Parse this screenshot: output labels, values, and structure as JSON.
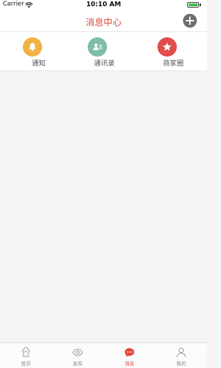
{
  "status_bar": {
    "carrier": "Carrier",
    "time": "10:10 AM",
    "battery_level": 1.0,
    "battery_color": "#37c14a"
  },
  "nav": {
    "title": "消息中心",
    "title_color": "#e0463f",
    "add_icon": "plus-circle-icon"
  },
  "categories": [
    {
      "label": "通知",
      "icon": "bell-icon",
      "color": "#f2b242"
    },
    {
      "label": "通讯录",
      "icon": "contacts-card-icon",
      "color": "#7fbda7"
    },
    {
      "label": "商家圈",
      "icon": "star-icon",
      "color": "#e14c4c"
    }
  ],
  "tabs": [
    {
      "label": "首页",
      "icon": "home-icon",
      "active": false
    },
    {
      "label": "发现",
      "icon": "eye-icon",
      "active": false
    },
    {
      "label": "消息",
      "icon": "chat-bubble-icon",
      "active": true
    },
    {
      "label": "我的",
      "icon": "person-icon",
      "active": false
    }
  ]
}
